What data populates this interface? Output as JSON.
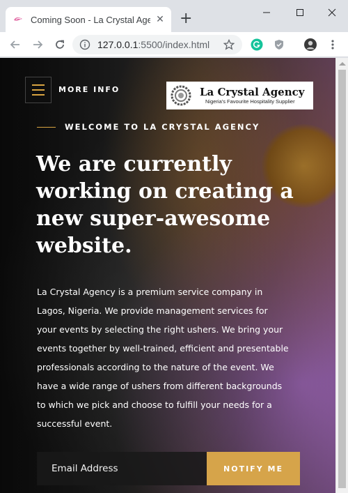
{
  "browser": {
    "tab_title": "Coming Soon - La Crystal Agency",
    "tab_close": "✕",
    "new_tab": "+",
    "url_host": "127.0.0.1",
    "url_rest": ":5500/index.html"
  },
  "page": {
    "menu_label": "MORE INFO",
    "logo": {
      "brand": "La Crystal Agency",
      "tagline": "Nigeria's Favourite Hospitality Supplier"
    },
    "welcome": "WELCOME TO LA CRYSTAL AGENCY",
    "headline": "We are currently working on creating a new super-awesome website.",
    "description": "La Crystal Agency is a premium service company in Lagos, Nigeria. We provide management services for your events by selecting the right ushers. We bring your events together by well-trained, efficient and presentable professionals according to the nature of the event. We have a wide range of ushers from different backgrounds to which we pick and choose to fulfill your needs for a successful event.",
    "email_placeholder": "Email Address",
    "notify_label": "NOTIFY ME"
  },
  "colors": {
    "accent": "#d6a44a"
  }
}
